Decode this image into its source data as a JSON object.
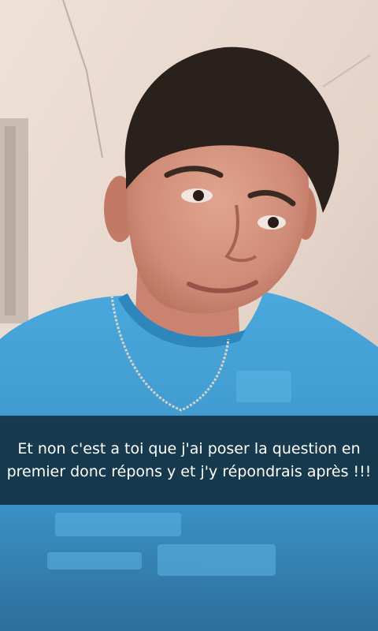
{
  "snap": {
    "caption": "Et non c'est a toi que j'ai poser la question en premier donc répons y et j'y répondrais après !!!"
  },
  "colors": {
    "shirt": "#3f9fd6",
    "wall": "#e8d9cf",
    "caption_bg": "#000000",
    "caption_text": "#ffffff"
  }
}
